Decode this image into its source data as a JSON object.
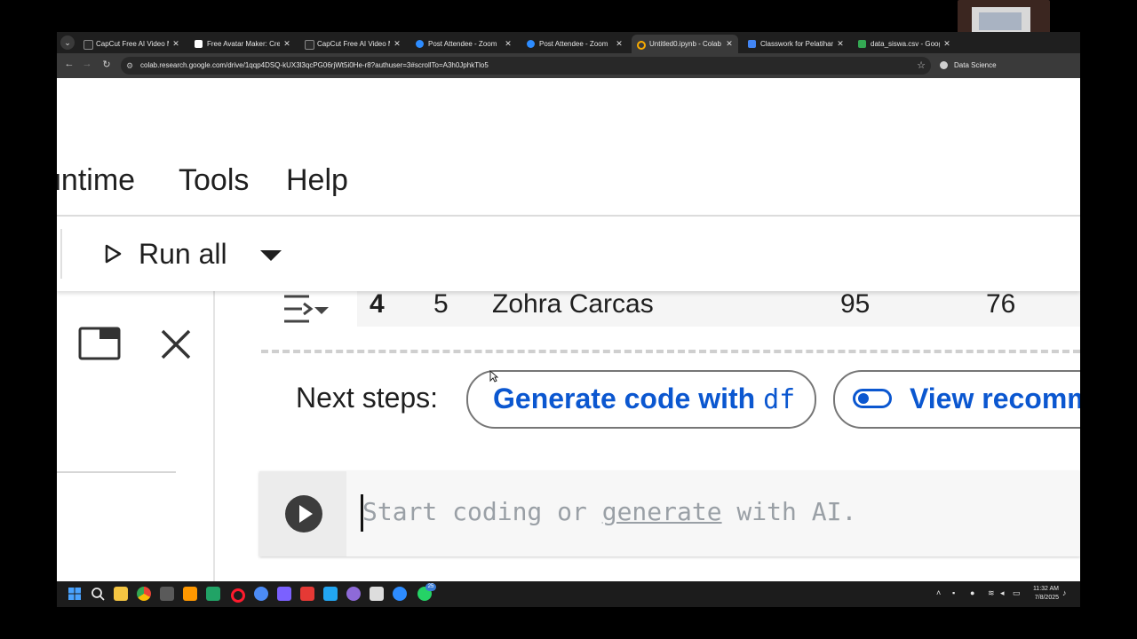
{
  "browser": {
    "tabs": [
      {
        "title": "CapCut Free AI Video Mak",
        "favicon_color": "#2b2b2b",
        "active": false
      },
      {
        "title": "Free Avatar Maker: Create",
        "favicon_color": "#ffffff",
        "active": false
      },
      {
        "title": "CapCut Free AI Video Mak",
        "favicon_color": "#2b2b2b",
        "active": false
      },
      {
        "title": "Post Attendee - Zoom",
        "favicon_color": "#2d8cff",
        "active": false
      },
      {
        "title": "Post Attendee - Zoom",
        "favicon_color": "#2d8cff",
        "active": false
      },
      {
        "title": "Untitled0.ipynb - Colab",
        "favicon_color": "#f9ab00",
        "active": true
      },
      {
        "title": "Classwork for Pelatihan K",
        "favicon_color": "#4285f4",
        "active": false
      },
      {
        "title": "data_siswa.csv - Google D",
        "favicon_color": "#34a853",
        "active": false
      }
    ],
    "url": "colab.research.google.com/drive/1qqp4DSQ-kUX3l3qcPG06rjWt5i0He-r8?authuser=3#scrollTo=A3h0JphkTlo5",
    "profile_label": "Data Science"
  },
  "colab": {
    "menu": [
      "untime",
      "Tools",
      "Help"
    ],
    "run_all_label": "Run all",
    "dataframe_last_row": [
      "4",
      "5",
      "Zohra Carcas",
      "95",
      "76"
    ],
    "next_steps_label": "Next steps:",
    "generate_code_label": "Generate code with",
    "generate_code_var": "df",
    "view_recommended_label": "View recomm",
    "placeholder": {
      "part1": "Start coding or ",
      "link": "generate",
      "part2": " with AI."
    }
  },
  "taskbar": {
    "apps": [
      {
        "name": "windows-start",
        "color": "#4aa3ff"
      },
      {
        "name": "search",
        "color": "#e8e8e8"
      },
      {
        "name": "file-explorer",
        "color": "#f4c542"
      },
      {
        "name": "chrome",
        "color": "#34a853"
      },
      {
        "name": "terminal",
        "color": "#5a5a5a"
      },
      {
        "name": "sublime",
        "color": "#ff9800"
      },
      {
        "name": "excel",
        "color": "#21a366"
      },
      {
        "name": "opera",
        "color": "#ff1b2d"
      },
      {
        "name": "app-hexagon",
        "color": "#4c8bf5"
      },
      {
        "name": "app-purple",
        "color": "#7b61ff"
      },
      {
        "name": "foxit",
        "color": "#e53935"
      },
      {
        "name": "vscode",
        "color": "#22a6f2"
      },
      {
        "name": "github-desktop",
        "color": "#8e6ad8"
      },
      {
        "name": "inkscape",
        "color": "#dddddd"
      },
      {
        "name": "zoom",
        "color": "#2d8cff"
      },
      {
        "name": "whatsapp",
        "color": "#25d366"
      }
    ],
    "whatsapp_badge": "25",
    "time": "11:32 AM",
    "date": "7/8/2025"
  }
}
